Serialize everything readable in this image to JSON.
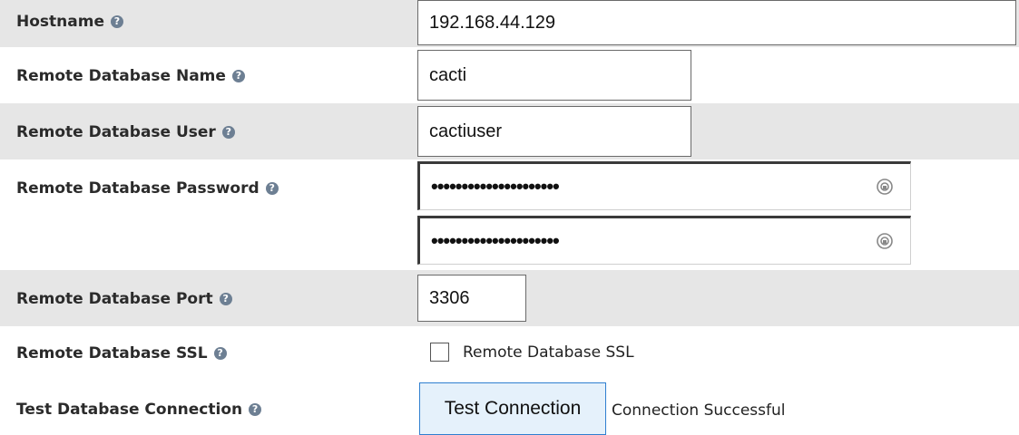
{
  "rows": {
    "hostname": {
      "label": "Hostname",
      "value": "192.168.44.129"
    },
    "db_name": {
      "label": "Remote Database Name",
      "value": "cacti"
    },
    "db_user": {
      "label": "Remote Database User",
      "value": "cactiuser"
    },
    "db_password": {
      "label": "Remote Database Password",
      "value": "•••••••••••••••••••••",
      "confirm_value": "•••••••••••••••••••••"
    },
    "db_port": {
      "label": "Remote Database Port",
      "value": "3306"
    },
    "db_ssl": {
      "label": "Remote Database SSL",
      "checkbox_label": "Remote Database SSL",
      "checked": false
    },
    "test_connection": {
      "label": "Test Database Connection",
      "button_label": "Test Connection",
      "status": "Connection Successful"
    }
  },
  "help_icon": "?"
}
